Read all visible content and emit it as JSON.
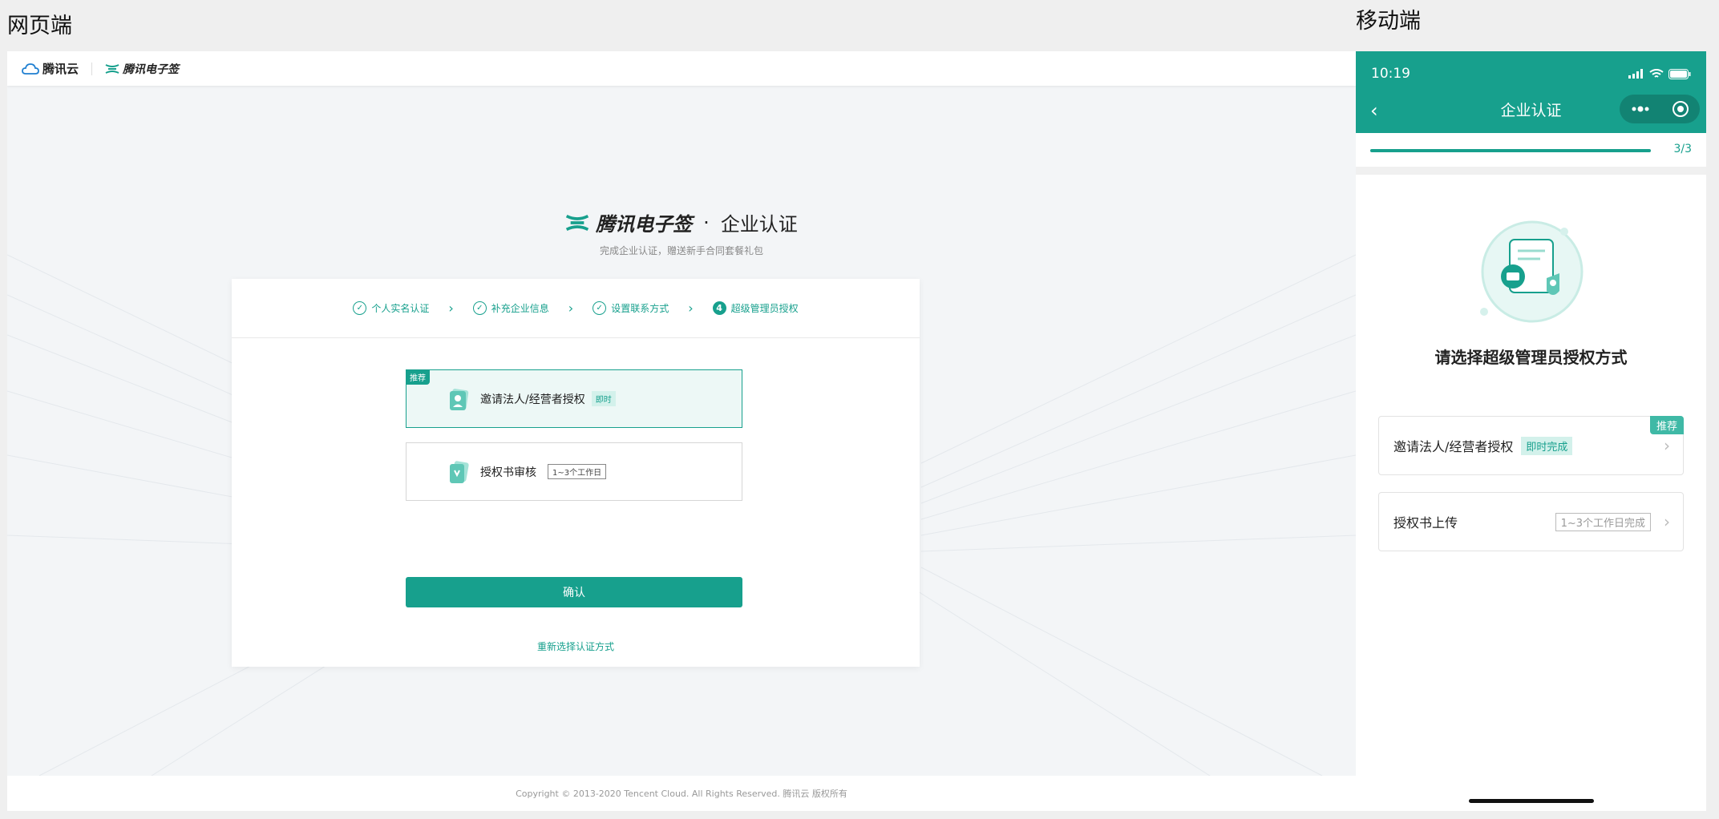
{
  "labels": {
    "web": "网页端",
    "mobile": "移动端"
  },
  "web": {
    "topbar": {
      "cloud_brand": "腾讯云",
      "esign_brand": "腾讯电子签"
    },
    "hero": {
      "brand": "腾讯电子签",
      "separator": "·",
      "title": "企业认证",
      "subtitle": "完成企业认证，赠送新手合同套餐礼包"
    },
    "steps": [
      {
        "label": "个人实名认证",
        "state": "done"
      },
      {
        "label": "补充企业信息",
        "state": "done"
      },
      {
        "label": "设置联系方式",
        "state": "done"
      },
      {
        "label": "超级管理员授权",
        "state": "current",
        "number": "4"
      }
    ],
    "options": [
      {
        "label": "邀请法人/经营者授权",
        "tag": "即时",
        "badge": "推荐",
        "selected": true
      },
      {
        "label": "授权书审核",
        "tag": "1~3个工作日",
        "selected": false
      }
    ],
    "confirm_label": "确认",
    "reselect_label": "重新选择认证方式",
    "footer": "Copyright © 2013-2020 Tencent Cloud. All Rights Reserved. 腾讯云 版权所有",
    "accent": "#17a08d"
  },
  "mobile": {
    "status": {
      "time": "10:19"
    },
    "nav": {
      "title": "企业认证",
      "back": "‹"
    },
    "progress": {
      "text": "3/3",
      "fraction": 1.0
    },
    "title": "请选择超级管理员授权方式",
    "options": [
      {
        "label": "邀请法人/经营者授权",
        "tag": "即时完成",
        "badge": "推荐"
      },
      {
        "label": "授权书上传",
        "tag": "1~3个工作日完成"
      }
    ]
  }
}
